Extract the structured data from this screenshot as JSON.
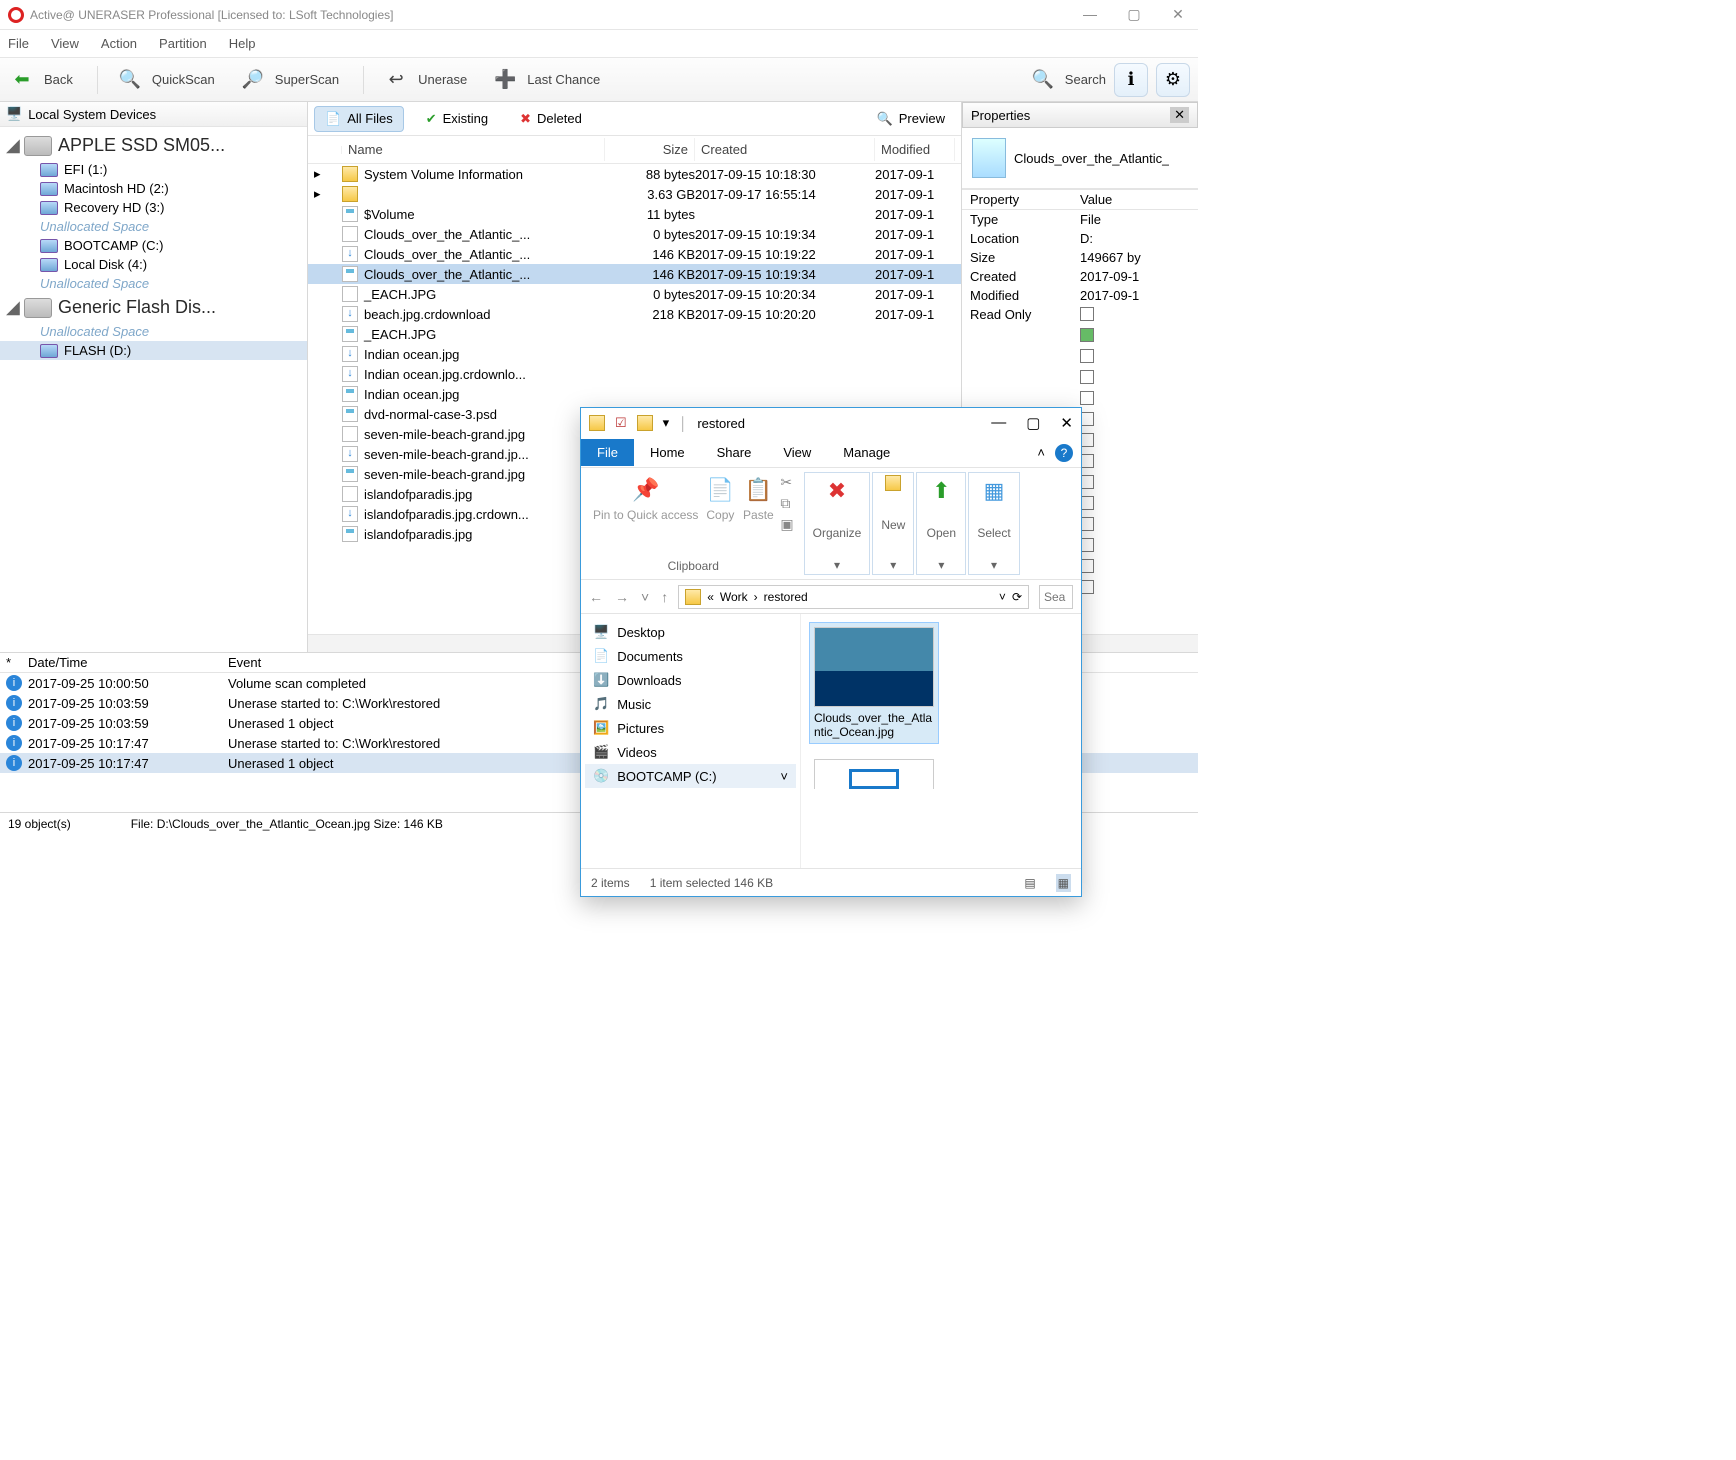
{
  "window": {
    "title": "Active@ UNERASER Professional [Licensed to: LSoft Technologies]"
  },
  "menus": [
    "File",
    "View",
    "Action",
    "Partition",
    "Help"
  ],
  "toolbar": {
    "back": "Back",
    "quickscan": "QuickScan",
    "superscan": "SuperScan",
    "unerase": "Unerase",
    "lastchance": "Last Chance",
    "search": "Search"
  },
  "sidebar": {
    "title": "Local System Devices",
    "devices": [
      {
        "label": "APPLE SSD SM05...",
        "type": "disk",
        "expanded": true,
        "children": [
          {
            "label": "EFI (1:)"
          },
          {
            "label": "Macintosh HD (2:)"
          },
          {
            "label": "Recovery HD (3:)"
          },
          {
            "label": "Unallocated Space",
            "unalloc": true
          },
          {
            "label": "BOOTCAMP (C:)"
          },
          {
            "label": "Local Disk (4:)"
          },
          {
            "label": "Unallocated Space",
            "unalloc": true
          }
        ]
      },
      {
        "label": "Generic Flash Dis...",
        "type": "usb",
        "expanded": true,
        "children": [
          {
            "label": "Unallocated Space",
            "unalloc": true
          },
          {
            "label": "FLASH (D:)",
            "selected": true
          }
        ]
      }
    ]
  },
  "filetabs": {
    "all": "All Files",
    "existing": "Existing",
    "deleted": "Deleted",
    "preview": "Preview"
  },
  "grid": {
    "cols": {
      "name": "Name",
      "size": "Size",
      "created": "Created",
      "modified": "Modified"
    },
    "rows": [
      {
        "arrow": true,
        "ic": "fold",
        "name": "System Volume Information",
        "size": "88 bytes",
        "created": "2017-09-15 10:18:30",
        "modified": "2017-09-1"
      },
      {
        "arrow": true,
        "ic": "fold",
        "name": "",
        "size": "3.63 GB",
        "created": "2017-09-17 16:55:14",
        "modified": "2017-09-1"
      },
      {
        "ic": "jpg",
        "name": "$Volume",
        "size": "11 bytes",
        "created": "",
        "modified": "2017-09-1"
      },
      {
        "ic": "file",
        "name": "Clouds_over_the_Atlantic_...",
        "size": "0 bytes",
        "created": "2017-09-15 10:19:34",
        "modified": "2017-09-1"
      },
      {
        "ic": "dl",
        "name": "Clouds_over_the_Atlantic_...",
        "size": "146 KB",
        "created": "2017-09-15 10:19:22",
        "modified": "2017-09-1"
      },
      {
        "ic": "jpg",
        "name": "Clouds_over_the_Atlantic_...",
        "size": "146 KB",
        "created": "2017-09-15 10:19:34",
        "modified": "2017-09-1",
        "sel": true
      },
      {
        "ic": "file",
        "name": "_EACH.JPG",
        "size": "0 bytes",
        "created": "2017-09-15 10:20:34",
        "modified": "2017-09-1"
      },
      {
        "ic": "dl",
        "name": "beach.jpg.crdownload",
        "size": "218 KB",
        "created": "2017-09-15 10:20:20",
        "modified": "2017-09-1"
      },
      {
        "ic": "jpg",
        "name": "_EACH.JPG",
        "size": "",
        "created": "",
        "modified": ""
      },
      {
        "ic": "dl",
        "name": "Indian ocean.jpg",
        "size": "",
        "created": "",
        "modified": ""
      },
      {
        "ic": "dl",
        "name": "Indian ocean.jpg.crdownlo...",
        "size": "",
        "created": "",
        "modified": ""
      },
      {
        "ic": "jpg",
        "name": "Indian ocean.jpg",
        "size": "",
        "created": "",
        "modified": ""
      },
      {
        "ic": "jpg",
        "name": "dvd-normal-case-3.psd",
        "size": "",
        "created": "",
        "modified": ""
      },
      {
        "ic": "file",
        "name": "seven-mile-beach-grand.jpg",
        "size": "",
        "created": "",
        "modified": ""
      },
      {
        "ic": "dl",
        "name": "seven-mile-beach-grand.jp...",
        "size": "",
        "created": "",
        "modified": ""
      },
      {
        "ic": "jpg",
        "name": "seven-mile-beach-grand.jpg",
        "size": "",
        "created": "",
        "modified": ""
      },
      {
        "ic": "file",
        "name": "islandofparadis.jpg",
        "size": "",
        "created": "",
        "modified": ""
      },
      {
        "ic": "dl",
        "name": "islandofparadis.jpg.crdown...",
        "size": "",
        "created": "",
        "modified": ""
      },
      {
        "ic": "jpg",
        "name": "islandofparadis.jpg",
        "size": "",
        "created": "",
        "modified": ""
      }
    ]
  },
  "properties": {
    "title": "Properties",
    "filename": "Clouds_over_the_Atlantic_",
    "hdr": {
      "prop": "Property",
      "val": "Value"
    },
    "rows": [
      {
        "p": "Type",
        "v": "File"
      },
      {
        "p": "Location",
        "v": "D:"
      },
      {
        "p": "Size",
        "v": "149667 by"
      },
      {
        "p": "Created",
        "v": "2017-09-1"
      },
      {
        "p": "Modified",
        "v": "2017-09-1"
      },
      {
        "p": "Read Only",
        "cb": true,
        "ck": false
      },
      {
        "p": "",
        "cb": true,
        "ck": true
      },
      {
        "p": "",
        "cb": true,
        "ck": false
      },
      {
        "p": "",
        "cb": true,
        "ck": false
      },
      {
        "p": "",
        "cb": true,
        "ck": false
      },
      {
        "p": "",
        "cb": true,
        "ck": false
      },
      {
        "p": "",
        "cb": true,
        "ck": false
      },
      {
        "p": "",
        "cb": true,
        "ck": false
      },
      {
        "p": "",
        "cb": true,
        "ck": false
      },
      {
        "p": "",
        "cb": true,
        "ck": false
      },
      {
        "p": "",
        "cb": true,
        "ck": false
      },
      {
        "p": "",
        "cb": true,
        "ck": false
      },
      {
        "p": "",
        "cb": true,
        "ck": false
      },
      {
        "p": "",
        "cb": true,
        "ck": false
      }
    ]
  },
  "log": {
    "cols": {
      "star": "*",
      "dt": "Date/Time",
      "ev": "Event"
    },
    "rows": [
      {
        "t": "2017-09-25 10:00:50",
        "e": "Volume scan completed"
      },
      {
        "t": "2017-09-25 10:03:59",
        "e": "Unerase started to: C:\\Work\\restored"
      },
      {
        "t": "2017-09-25 10:03:59",
        "e": "Unerased 1 object"
      },
      {
        "t": "2017-09-25 10:17:47",
        "e": "Unerase started to: C:\\Work\\restored"
      },
      {
        "t": "2017-09-25 10:17:47",
        "e": "Unerased 1 object",
        "sel": true
      }
    ]
  },
  "status": {
    "objects": "19 object(s)",
    "file": "File: D:\\Clouds_over_the_Atlantic_Ocean.jpg Size: 146 KB"
  },
  "explorer": {
    "title": "restored",
    "tabs": {
      "file": "File",
      "home": "Home",
      "share": "Share",
      "view": "View",
      "manage": "Manage"
    },
    "ribbon": {
      "pin": "Pin to Quick access",
      "copy": "Copy",
      "paste": "Paste",
      "clipboard": "Clipboard",
      "organize": "Organize",
      "new": "New",
      "open": "Open",
      "select": "Select"
    },
    "path": {
      "a": "«",
      "b": "Work",
      "c": "restored"
    },
    "search_placeholder": "Sea",
    "nav": [
      {
        "ic": "🖥️",
        "t": "Desktop"
      },
      {
        "ic": "📄",
        "t": "Documents"
      },
      {
        "ic": "⬇️",
        "t": "Downloads"
      },
      {
        "ic": "🎵",
        "t": "Music"
      },
      {
        "ic": "🖼️",
        "t": "Pictures"
      },
      {
        "ic": "🎬",
        "t": "Videos"
      },
      {
        "ic": "💿",
        "t": "BOOTCAMP (C:)",
        "sel": true
      }
    ],
    "thumb": "Clouds_over_the_Atlantic_Ocean.jpg",
    "status": {
      "items": "2 items",
      "sel": "1 item selected  146 KB"
    }
  }
}
